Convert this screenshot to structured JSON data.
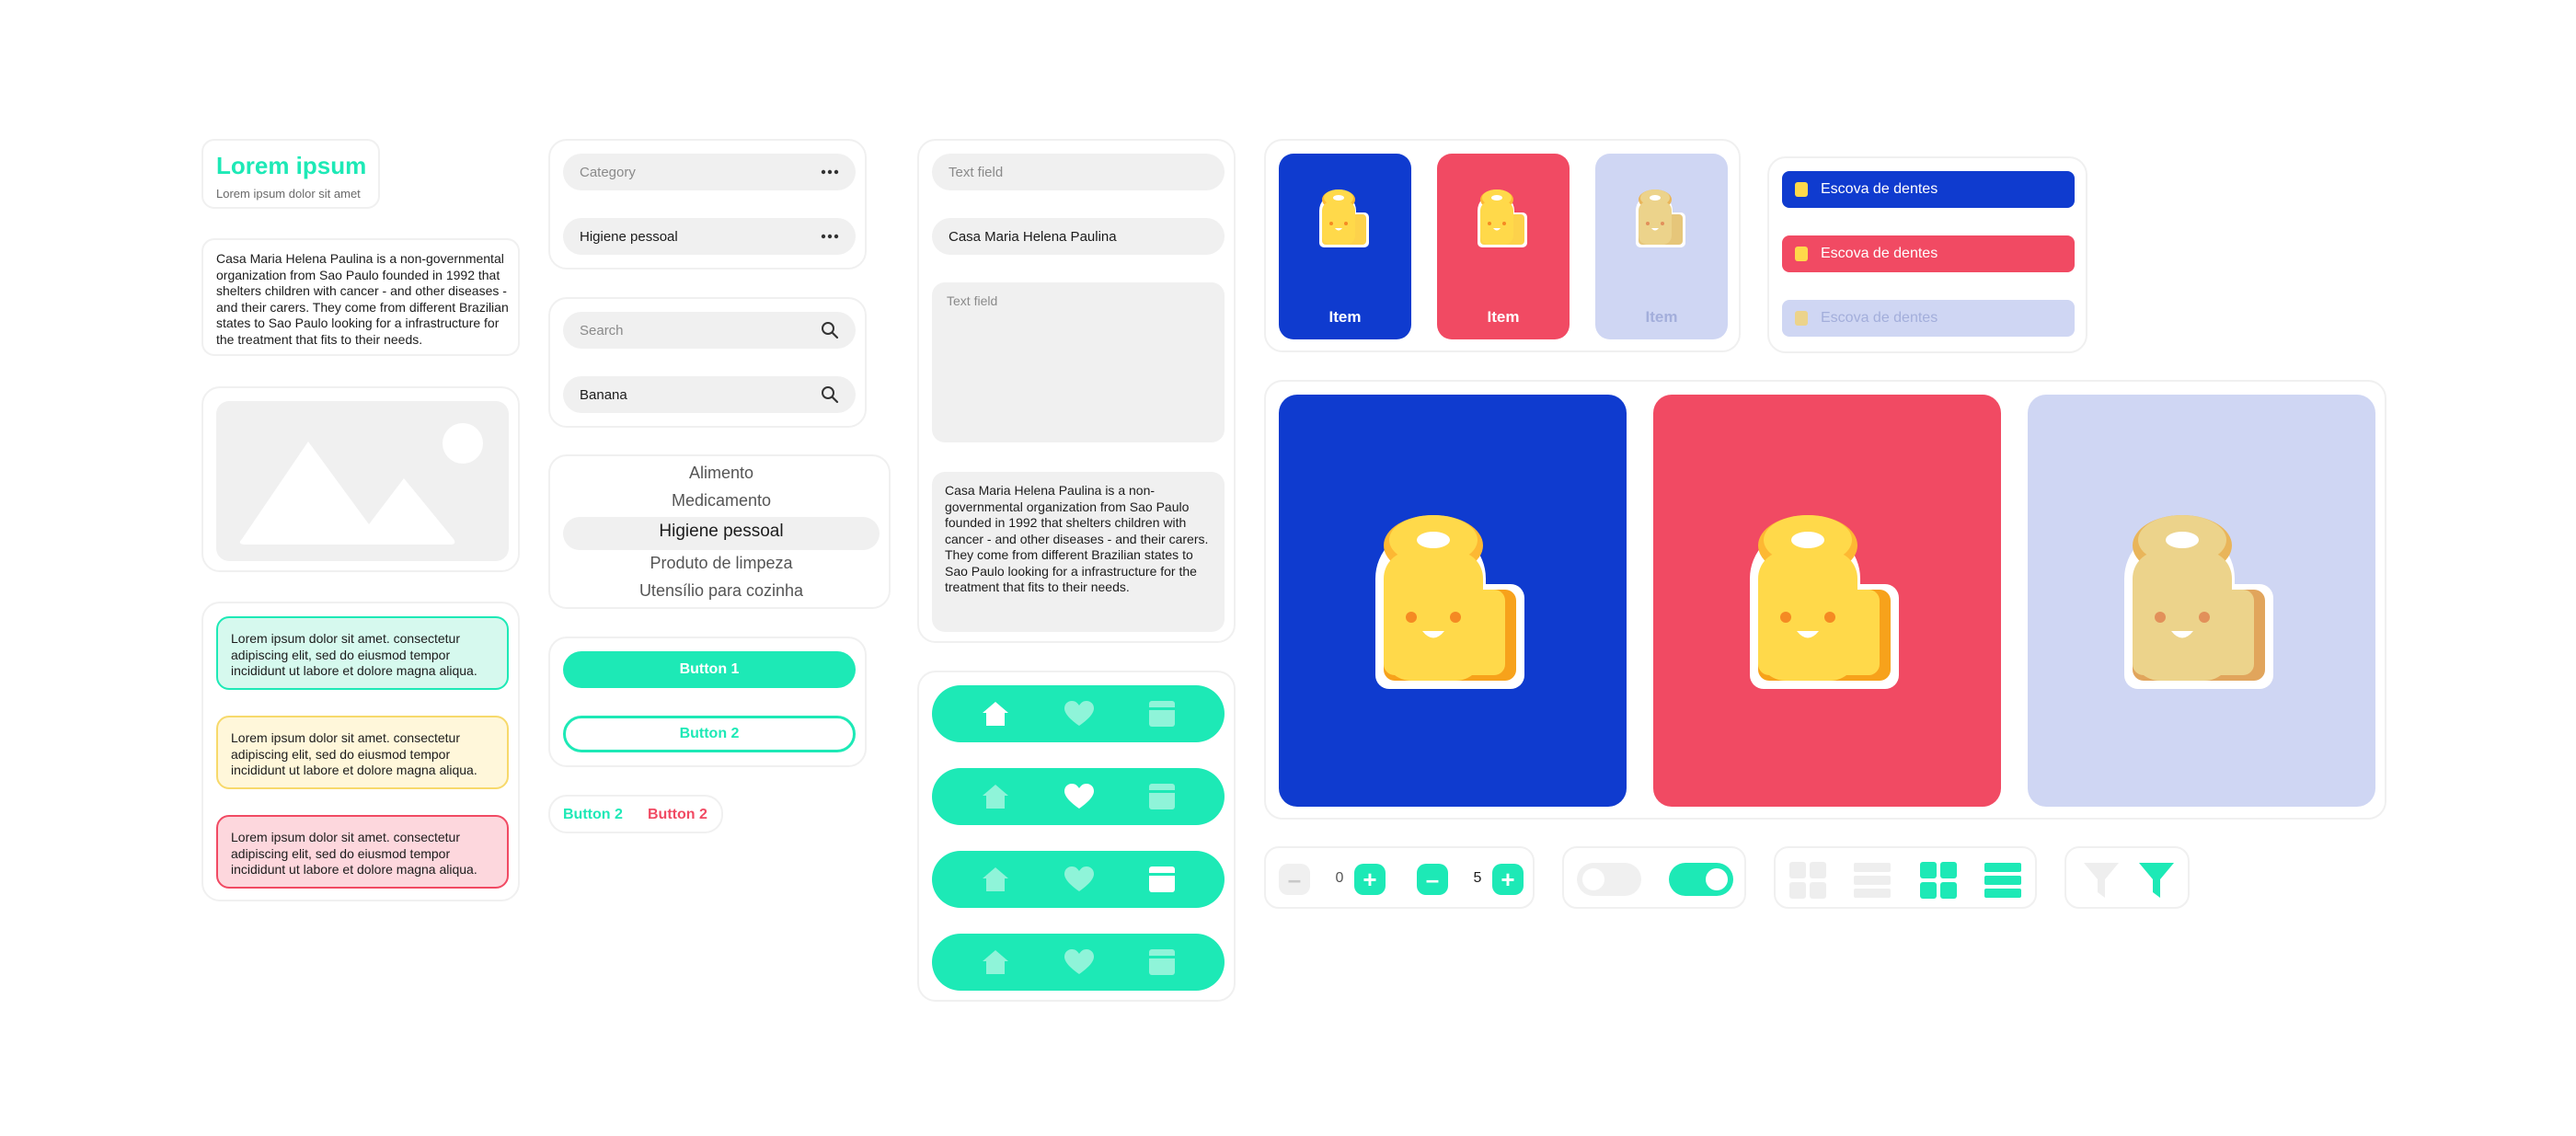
{
  "colors": {
    "accent": "#1de9b6",
    "blue": "#0f3bcf",
    "red": "#f14a63",
    "lavender": "#cfd6f3",
    "gray": "#f0f0f0",
    "mint_bg": "#d6f9ee",
    "yellow_bg": "#fff7da",
    "yellow_border": "#f7d96b",
    "pink_bg": "#fdd7dd"
  },
  "header_card": {
    "title": "Lorem ipsum",
    "subtitle": "Lorem ipsum dolor sit amet"
  },
  "description": "Casa Maria Helena Paulina is a non-governmental organization from Sao Paulo founded in 1992 that shelters children with cancer - and other diseases - and their carers. They come from different Brazilian states to Sao Paulo looking for a infrastructure for the treatment that fits to their needs.",
  "image_placeholder": {
    "icon": "image-placeholder-icon"
  },
  "alerts": [
    {
      "text": "Lorem ipsum dolor sit amet. consectetur adipiscing elit, sed do eiusmod tempor incididunt ut labore et dolore magna aliqua."
    },
    {
      "text": "Lorem ipsum dolor sit amet. consectetur adipiscing elit, sed do eiusmod tempor incididunt ut labore et dolore magna aliqua."
    },
    {
      "text": "Lorem ipsum dolor sit amet. consectetur adipiscing elit, sed do eiusmod tempor incididunt ut labore et dolore magna aliqua."
    }
  ],
  "dropdowns": [
    {
      "label": "Category",
      "icon": "more-horizontal-icon"
    },
    {
      "label": "Higiene pessoal",
      "icon": "more-horizontal-icon"
    }
  ],
  "search": {
    "placeholder": "Search",
    "value": "Banana",
    "icon": "search-icon"
  },
  "picker": {
    "items": [
      "Alimento",
      "Medicamento",
      "Higiene pessoal",
      "Produto de limpeza",
      "Utensílio para cozinha"
    ],
    "selected": "Higiene pessoal"
  },
  "buttons": {
    "primary": "Button 1",
    "outline": "Button 2",
    "text_accent": "Button 2",
    "text_red": "Button 2"
  },
  "text_fields": {
    "placeholder1": "Text field",
    "value1": "Casa Maria Helena Paulina",
    "textarea_placeholder": "Text field",
    "textarea_value": "Casa Maria Helena Paulina is a non-governmental organization from Sao Paulo founded in 1992 that shelters children with cancer - and other diseases - and their carers. They come from different Brazilian states to Sao Paulo looking for a infrastructure for the treatment that fits to their needs."
  },
  "nav_bars": {
    "icons": [
      "home-icon",
      "heart-icon",
      "box-icon"
    ]
  },
  "tiles": [
    {
      "label": "Item",
      "state": "blue"
    },
    {
      "label": "Item",
      "state": "red"
    },
    {
      "label": "Item",
      "state": "disabled"
    }
  ],
  "list_bars": [
    {
      "label": "Escova de dentes",
      "state": "blue"
    },
    {
      "label": "Escova de dentes",
      "state": "red"
    },
    {
      "label": "Escova de dentes",
      "state": "disabled"
    }
  ],
  "steppers": [
    {
      "value": "0",
      "state": "disabled-minus"
    },
    {
      "value": "5",
      "state": "active"
    }
  ],
  "toggles": [
    {
      "on": false
    },
    {
      "on": true
    }
  ],
  "view_modes": [
    "grid-view-icon",
    "list-view-icon",
    "grid-view-icon",
    "list-view-icon"
  ],
  "filters": [
    "filter-icon",
    "filter-icon"
  ]
}
